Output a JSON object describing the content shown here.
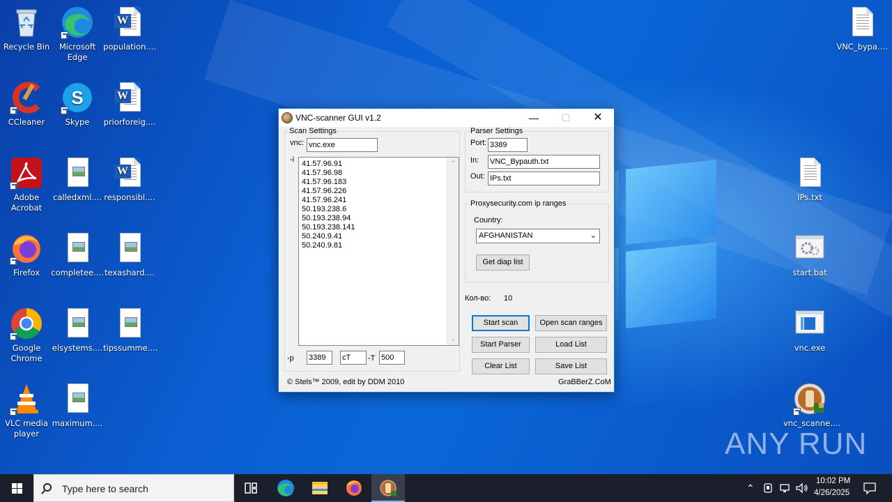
{
  "desktop": {
    "icons": [
      {
        "label": "Recycle Bin",
        "icon": "recycle-bin-icon"
      },
      {
        "label": "Microsoft Edge",
        "icon": "edge-icon"
      },
      {
        "label": "population....",
        "icon": "word-doc-icon"
      },
      {
        "label": "CCleaner",
        "icon": "ccleaner-icon"
      },
      {
        "label": "Skype",
        "icon": "skype-icon"
      },
      {
        "label": "priorforeig....",
        "icon": "word-doc-icon"
      },
      {
        "label": "Adobe Acrobat",
        "icon": "acrobat-icon"
      },
      {
        "label": "calledxml....",
        "icon": "image-file-icon"
      },
      {
        "label": "responsibl....",
        "icon": "word-doc-icon"
      },
      {
        "label": "Firefox",
        "icon": "firefox-icon"
      },
      {
        "label": "completee....",
        "icon": "image-file-icon"
      },
      {
        "label": "texashard....",
        "icon": "image-file-icon"
      },
      {
        "label": "Google Chrome",
        "icon": "chrome-icon"
      },
      {
        "label": "elsystems....",
        "icon": "image-file-icon"
      },
      {
        "label": "tipssumme....",
        "icon": "image-file-icon"
      },
      {
        "label": "VLC media player",
        "icon": "vlc-icon"
      },
      {
        "label": "maximum....",
        "icon": "image-file-icon"
      },
      {
        "label": "VNC_bypa....",
        "icon": "text-file-icon"
      },
      {
        "label": "IPs.txt",
        "icon": "text-file-icon"
      },
      {
        "label": "start.bat",
        "icon": "bat-file-icon"
      },
      {
        "label": "vnc.exe",
        "icon": "exe-file-icon"
      },
      {
        "label": "vnc_scanne....",
        "icon": "vnc-scanner-icon"
      }
    ],
    "watermark": "ANY RUN"
  },
  "window": {
    "title": "VNC-scanner GUI v1.2",
    "scan_settings": {
      "group_label": "Scan Settings",
      "vnc_label": "vnc:",
      "vnc_value": "vnc.exe",
      "i_label": "-i",
      "ip_list": [
        "41.57.96.91",
        "41.57.96.98",
        "41.57.96.183",
        "41.57.96.226",
        "41.57.96.241",
        "50.193.238.6",
        "50.193.238.94",
        "50.193.238.141",
        "50.240.9.41",
        "50.240.9.81"
      ],
      "p_label": "-p",
      "p_value": "3389",
      "ct_value": "cT",
      "t_label": "-T",
      "t_value": "500"
    },
    "parser_settings": {
      "group_label": "Parser Settings",
      "port_label": "Port:",
      "port_value": "3389",
      "in_label": "In:",
      "in_value": "VNC_Bypauth.txt",
      "out_label": "Out:",
      "out_value": "IPs.txt"
    },
    "proxy": {
      "group_label": "Proxysecurity.com ip ranges",
      "country_label": "Country:",
      "country_value": "AFGHANISTAN",
      "get_diap_label": "Get diap list"
    },
    "count_label": "Кол-во:",
    "count_value": "10",
    "buttons": {
      "start_scan": "Start scan",
      "open_scan_ranges": "Open scan ranges",
      "start_parser": "Start Parser",
      "load_list": "Load List",
      "clear_list": "Clear List",
      "save_list": "Save List"
    },
    "footer_left": "© Stels™  2009, edit by DDM 2010",
    "footer_right": "GraBBerZ.CoM"
  },
  "taskbar": {
    "search_placeholder": "Type here to search",
    "time": "10:02 PM",
    "date": "4/26/2025",
    "items": [
      "task-view-icon",
      "edge-icon",
      "file-explorer-icon",
      "firefox-icon",
      "vnc-scanner-icon"
    ]
  }
}
